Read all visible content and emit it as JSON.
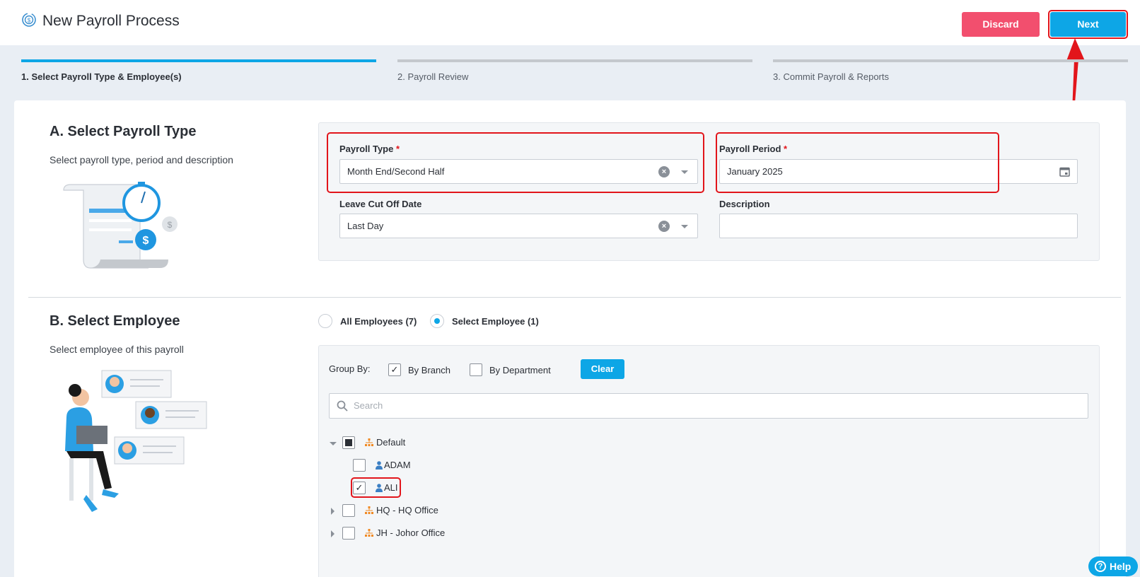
{
  "header": {
    "title": "New Payroll Process",
    "discard_label": "Discard",
    "next_label": "Next"
  },
  "steps": [
    {
      "label": "1. Select Payroll Type & Employee(s)",
      "active": true
    },
    {
      "label": "2. Payroll Review",
      "active": false
    },
    {
      "label": "3. Commit Payroll & Reports",
      "active": false
    }
  ],
  "section_a": {
    "title": "A. Select Payroll Type",
    "description": "Select payroll type, period and description",
    "payroll_type": {
      "label": "Payroll Type",
      "required": "*",
      "value": "Month End/Second Half"
    },
    "payroll_period": {
      "label": "Payroll Period",
      "required": "*",
      "value": "January 2025"
    },
    "leave_cutoff": {
      "label": "Leave Cut Off Date",
      "value": "Last Day"
    },
    "description_field": {
      "label": "Description",
      "value": ""
    }
  },
  "section_b": {
    "title": "B. Select Employee",
    "description": "Select employee of this payroll",
    "radio_all": "All Employees (7)",
    "radio_select": "Select Employee (1)",
    "group_by_label": "Group By:",
    "by_branch": "By Branch",
    "by_department": "By Department",
    "clear_label": "Clear",
    "search_placeholder": "Search",
    "tree": {
      "default_branch": "Default",
      "employees": [
        "ADAM",
        "ALI"
      ],
      "hq_branch": "HQ - HQ Office",
      "jh_branch": "JH - Johor Office"
    }
  },
  "help_label": "Help",
  "colors": {
    "accent": "#0da6e6",
    "discard": "#f24f6e",
    "highlight": "#e2151b",
    "branch_icon": "#f08a24",
    "person_icon": "#3b7fc4"
  }
}
